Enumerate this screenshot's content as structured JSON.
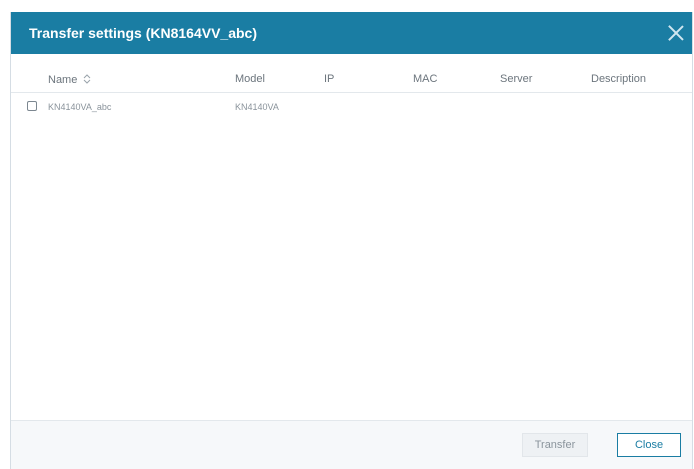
{
  "dialog": {
    "title": "Transfer settings (KN8164VV_abc)",
    "close_icon": "close-icon"
  },
  "table": {
    "columns": {
      "name": "Name",
      "model": "Model",
      "ip": "IP",
      "mac": "MAC",
      "server": "Server",
      "description": "Description"
    },
    "sort_icon": "sort-icon",
    "rows": [
      {
        "checked": false,
        "name": "KN4140VA_abc",
        "model": "KN4140VA",
        "ip": "",
        "mac": "",
        "server": "",
        "description": ""
      }
    ]
  },
  "footer": {
    "transfer_label": "Transfer",
    "close_label": "Close"
  },
  "colors": {
    "titlebar": "#1a7da3",
    "accent": "#1a7da3",
    "footer_bg": "#f6f8fa"
  }
}
